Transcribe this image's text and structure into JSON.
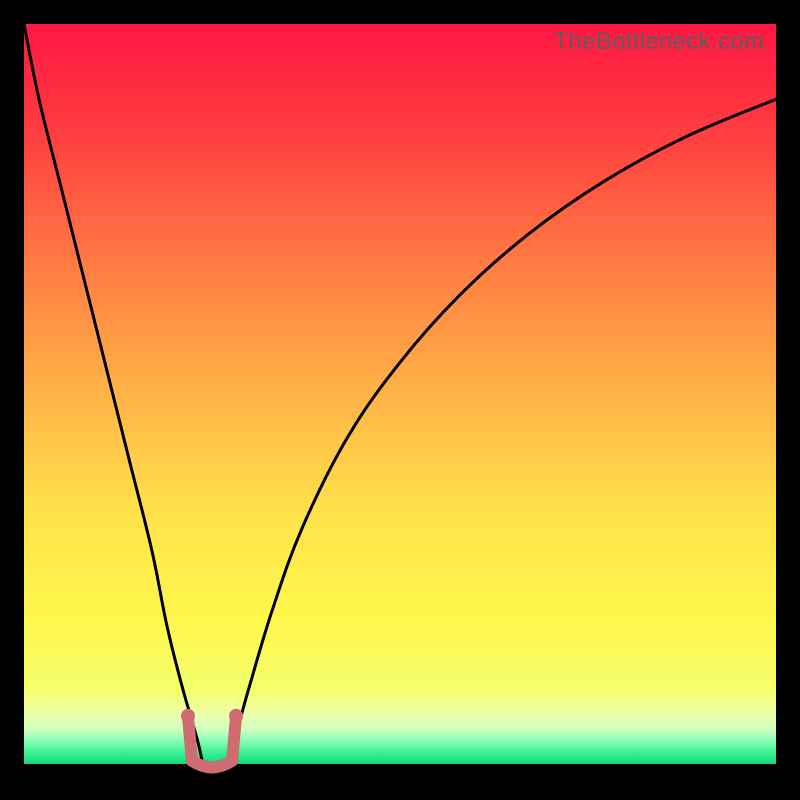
{
  "watermark": "TheBottleneck.com",
  "chart_data": {
    "type": "line",
    "title": "",
    "xlabel": "",
    "ylabel": "",
    "xlim": [
      0,
      100
    ],
    "ylim": [
      0,
      100
    ],
    "grid": false,
    "series": [
      {
        "name": "bottleneck-curve",
        "x": [
          0,
          2,
          5,
          8,
          11,
          14,
          17,
          19,
          21,
          23,
          24,
          25,
          26.5,
          28,
          30,
          33,
          37,
          43,
          50,
          58,
          67,
          77,
          88,
          100
        ],
        "y": [
          100,
          90,
          78,
          66,
          54,
          42,
          30,
          20,
          12,
          5,
          1,
          0,
          1,
          5,
          12,
          22,
          33,
          45,
          55,
          64,
          72,
          79,
          85,
          90
        ]
      }
    ],
    "marker_band": {
      "name": "optimal-range",
      "x_center": 25,
      "x_half_width": 3.2,
      "y_level": 2,
      "color": "#ce6c72"
    },
    "gradient_stops": [
      {
        "pct": 0,
        "color": "#ff1744"
      },
      {
        "pct": 14,
        "color": "#ff3b3f"
      },
      {
        "pct": 32,
        "color": "#ff7a43"
      },
      {
        "pct": 50,
        "color": "#ffb347"
      },
      {
        "pct": 66,
        "color": "#ffe24a"
      },
      {
        "pct": 80,
        "color": "#fff64c"
      },
      {
        "pct": 90,
        "color": "#f4ff6a"
      },
      {
        "pct": 93,
        "color": "#edffa8"
      },
      {
        "pct": 95.5,
        "color": "#ccffc1"
      },
      {
        "pct": 97,
        "color": "#7dffb1"
      },
      {
        "pct": 99,
        "color": "#28e98c"
      },
      {
        "pct": 100,
        "color": "#13d477"
      }
    ]
  }
}
